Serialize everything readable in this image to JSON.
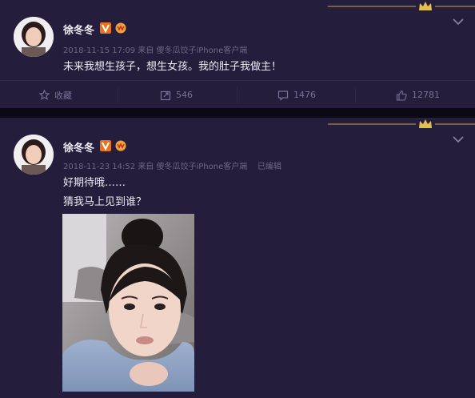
{
  "posts": [
    {
      "author": "徐冬冬",
      "time": "2018-11-15 17:09",
      "source_prefix": "来自",
      "source": "傻冬瓜饺子iPhone客户端",
      "edited": "",
      "lines": [
        "未来我想生孩子，想生女孩。我的肚子我做主！"
      ],
      "actions": {
        "favorite": "收藏",
        "repost": "546",
        "comment": "1476",
        "like": "12781"
      }
    },
    {
      "author": "徐冬冬",
      "time": "2018-11-23 14:52",
      "source_prefix": "来自",
      "source": "傻冬瓜饺子iPhone客户端",
      "edited": "已编辑",
      "lines": [
        "好期待哦……",
        "猜我马上见到谁？"
      ]
    }
  ],
  "colors": {
    "card": "#241d3b",
    "gold": "#c9a54a",
    "accent_orange": "#e8731f"
  },
  "icons": [
    "crown-icon",
    "chevron-down-icon",
    "verified-v-icon",
    "member-badge-icon",
    "star-icon",
    "repost-icon",
    "comment-icon",
    "like-icon"
  ]
}
